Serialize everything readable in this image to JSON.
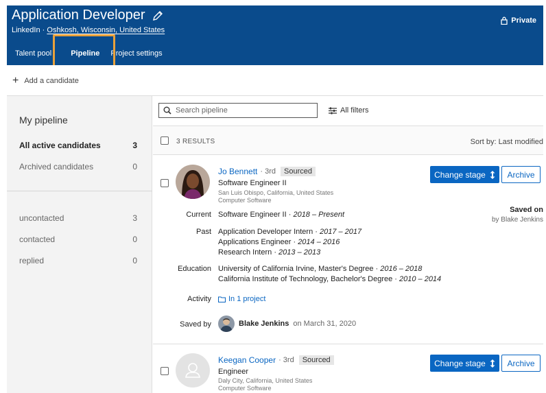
{
  "header": {
    "title": "Application Developer",
    "source": "LinkedIn",
    "separator": "·",
    "location": "Oshkosh, Wisconsin, United States",
    "privacy": "Private",
    "tabs": [
      {
        "label": "Talent pool"
      },
      {
        "label": "Pipeline"
      },
      {
        "label": "Project settings"
      }
    ]
  },
  "toolbar": {
    "add_candidate": "Add a candidate"
  },
  "sidebar": {
    "title": "My pipeline",
    "groups": [
      {
        "label": "All active candidates",
        "count": "3"
      },
      {
        "label": "Archived candidates",
        "count": "0"
      }
    ],
    "stages": [
      {
        "label": "uncontacted",
        "count": "3"
      },
      {
        "label": "contacted",
        "count": "0"
      },
      {
        "label": "replied",
        "count": "0"
      }
    ]
  },
  "main": {
    "search_placeholder": "Search pipeline",
    "filters_label": "All filters",
    "results_count": "3 RESULTS",
    "sort_label": "Sort by: Last modified"
  },
  "candidates": [
    {
      "name": "Jo Bennett",
      "degree": "· 3rd",
      "status": "Sourced",
      "headline": "Software Engineer II",
      "location": "San Luis Obispo, California, United States",
      "industry": "Computer Software",
      "change_stage": "Change stage",
      "archive": "Archive",
      "saved_on": "Saved on",
      "saved_by_right": "by Blake Jenkins",
      "current_label": "Current",
      "current_title": "Software Engineer II · ",
      "current_dates": "2018 – Present",
      "past_label": "Past",
      "past": [
        {
          "title": "Application Developer Intern · ",
          "dates": "2017 – 2017"
        },
        {
          "title": "Applications Engineer · ",
          "dates": "2014 – 2016"
        },
        {
          "title": "Research Intern · ",
          "dates": "2013 – 2013"
        }
      ],
      "education_label": "Education",
      "education": [
        {
          "school": "University of California Irvine, Master's Degree · ",
          "dates": "2016 – 2018"
        },
        {
          "school": "California Institute of Technology, Bachelor's Degree · ",
          "dates": "2010 – 2014"
        }
      ],
      "activity_label": "Activity",
      "activity": "In 1 project",
      "saved_by_label": "Saved by",
      "saver_name": "Blake Jenkins",
      "saved_date": "on March 31, 2020"
    },
    {
      "name": "Keegan Cooper",
      "degree": "· 3rd",
      "status": "Sourced",
      "headline": "Engineer",
      "location": "Daly City, California, United States",
      "industry": "Computer Software",
      "change_stage": "Change stage",
      "archive": "Archive"
    }
  ],
  "colors": {
    "header_bg": "#0a4b8c",
    "accent": "#0a66c2",
    "highlight": "#e9a13b"
  }
}
